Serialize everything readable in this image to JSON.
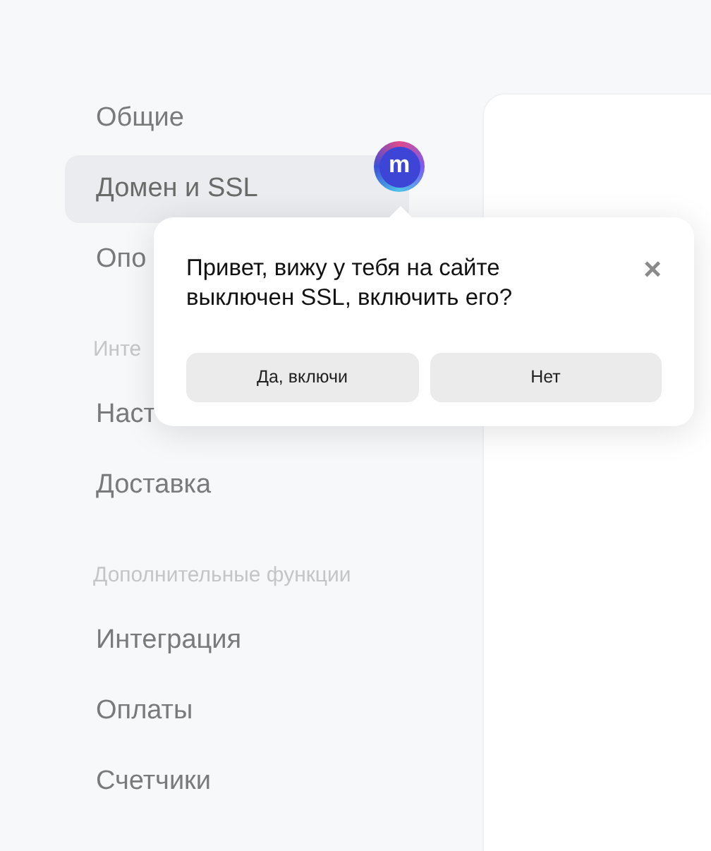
{
  "sidebar": {
    "sections": [
      {
        "items": [
          {
            "label": "Общие",
            "selected": false
          },
          {
            "label": "Домен и SSL",
            "selected": true
          },
          {
            "label": "Опо",
            "selected": false
          }
        ]
      },
      {
        "title": "Инте",
        "items": [
          {
            "label": "Наст",
            "selected": false
          },
          {
            "label": "Доставка",
            "selected": false
          }
        ]
      },
      {
        "title": "Дополнительные функции",
        "items": [
          {
            "label": "Интеграция",
            "selected": false
          },
          {
            "label": "Оплаты",
            "selected": false
          },
          {
            "label": "Счетчики",
            "selected": false
          }
        ]
      }
    ]
  },
  "assistant": {
    "avatar_letter": "m",
    "message": "Привет, вижу у тебя на сайте выключен SSL, включить его?",
    "close": "×",
    "buttons": [
      "Да, включи",
      "Нет"
    ]
  }
}
